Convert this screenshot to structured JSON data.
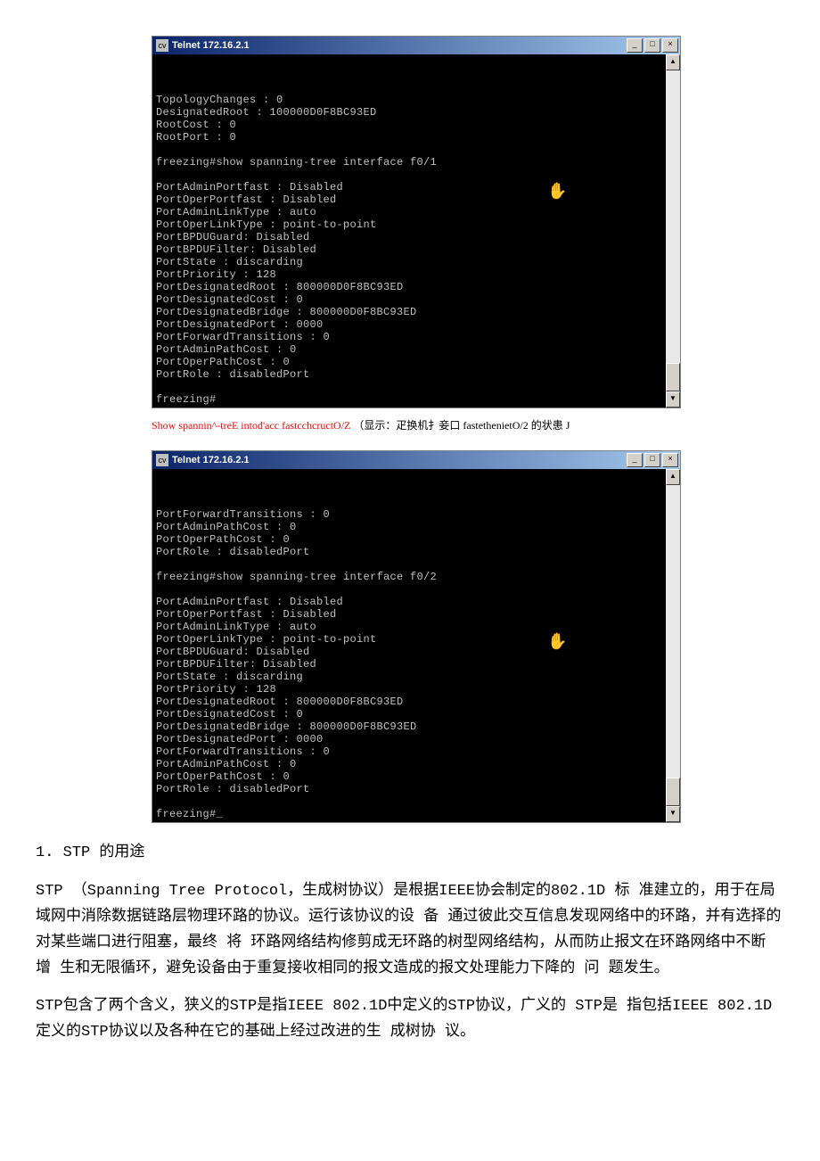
{
  "window1": {
    "title": "Telnet 172.16.2.1",
    "icon": "cv",
    "lines": [
      "TopologyChanges : 0",
      "DesignatedRoot : 100000D0F8BC93ED",
      "RootCost : 0",
      "RootPort : 0",
      "",
      "freezing#show spanning-tree interface f0/1",
      "",
      "PortAdminPortfast : Disabled",
      "PortOperPortfast : Disabled",
      "PortAdminLinkType : auto",
      "PortOperLinkType : point-to-point",
      "PortBPDUGuard: Disabled",
      "PortBPDUFilter: Disabled",
      "PortState : discarding",
      "PortPriority : 128",
      "PortDesignatedRoot : 800000D0F8BC93ED",
      "PortDesignatedCost : 0",
      "PortDesignatedBridge : 800000D0F8BC93ED",
      "PortDesignatedPort : 0000",
      "PortForwardTransitions : 0",
      "PortAdminPathCost : 0",
      "PortOperPathCost : 0",
      "PortRole : disabledPort",
      "",
      "freezing#"
    ]
  },
  "caption1_red": "Show spannin^-treE intod'acc fastcchcructO/Z ",
  "caption1_black": "（显示：疋换机扌妾口  fastethenietO/2 的状患  J",
  "window2": {
    "title": "Telnet 172.16.2.1",
    "icon": "cv",
    "lines": [
      "PortForwardTransitions : 0",
      "PortAdminPathCost : 0",
      "PortOperPathCost : 0",
      "PortRole : disabledPort",
      "",
      "freezing#show spanning-tree interface f0/2",
      "",
      "PortAdminPortfast : Disabled",
      "PortOperPortfast : Disabled",
      "PortAdminLinkType : auto",
      "PortOperLinkType : point-to-point",
      "PortBPDUGuard: Disabled",
      "PortBPDUFilter: Disabled",
      "PortState : discarding",
      "PortPriority : 128",
      "PortDesignatedRoot : 800000D0F8BC93ED",
      "PortDesignatedCost : 0",
      "PortDesignatedBridge : 800000D0F8BC93ED",
      "PortDesignatedPort : 0000",
      "PortForwardTransitions : 0",
      "PortAdminPathCost : 0",
      "PortOperPathCost : 0",
      "PortRole : disabledPort",
      "",
      "freezing#"
    ]
  },
  "doc": {
    "heading": "1. STP 的用途",
    "p1": "STP （Spanning Tree Protocol，生成树协议）是根据IEEE协会制定的802.1D 标 准建立的，用于在局域网中消除数据链路层物理环路的协议。运行该协议的设 备 通过彼此交互信息发现网络中的环路，并有选择的对某些端口进行阻塞，最终 将 环路网络结构修剪成无环路的树型网络结构，从而防止报文在环路网络中不断 增 生和无限循环，避免设备由于重复接收相同的报文造成的报文处理能力下降的 问 题发生。",
    "p2": "STP包含了两个含义，狭义的STP是指IEEE 802.1D中定义的STP协议，广义的 STP是 指包括IEEE 802.1D定义的STP协议以及各种在它的基础上经过改进的生 成树协 议。"
  }
}
